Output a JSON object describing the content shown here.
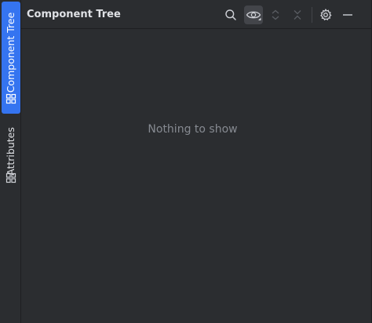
{
  "side_tabs": [
    {
      "label": "Component Tree",
      "icon": "component-tree-icon",
      "active": true
    },
    {
      "label": "Attributes",
      "icon": "attributes-icon",
      "active": false
    }
  ],
  "panel": {
    "title": "Component Tree",
    "empty_message": "Nothing to show"
  },
  "toolbar": [
    {
      "name": "search",
      "icon": "search-icon",
      "enabled": true
    },
    {
      "name": "view-options",
      "icon": "eye-icon",
      "enabled": true,
      "pressed": true
    },
    {
      "name": "expand-all",
      "icon": "expand-all-icon",
      "enabled": false
    },
    {
      "name": "collapse-all",
      "icon": "collapse-all-icon",
      "enabled": false
    },
    {
      "name": "settings",
      "icon": "gear-icon",
      "enabled": true
    },
    {
      "name": "minimize",
      "icon": "minimize-icon",
      "enabled": true
    }
  ],
  "colors": {
    "background": "#2b2d30",
    "accent": "#3574f0",
    "text": "#dfe1e5",
    "muted_text": "#868a91",
    "disabled_icon": "#5a5d63"
  }
}
